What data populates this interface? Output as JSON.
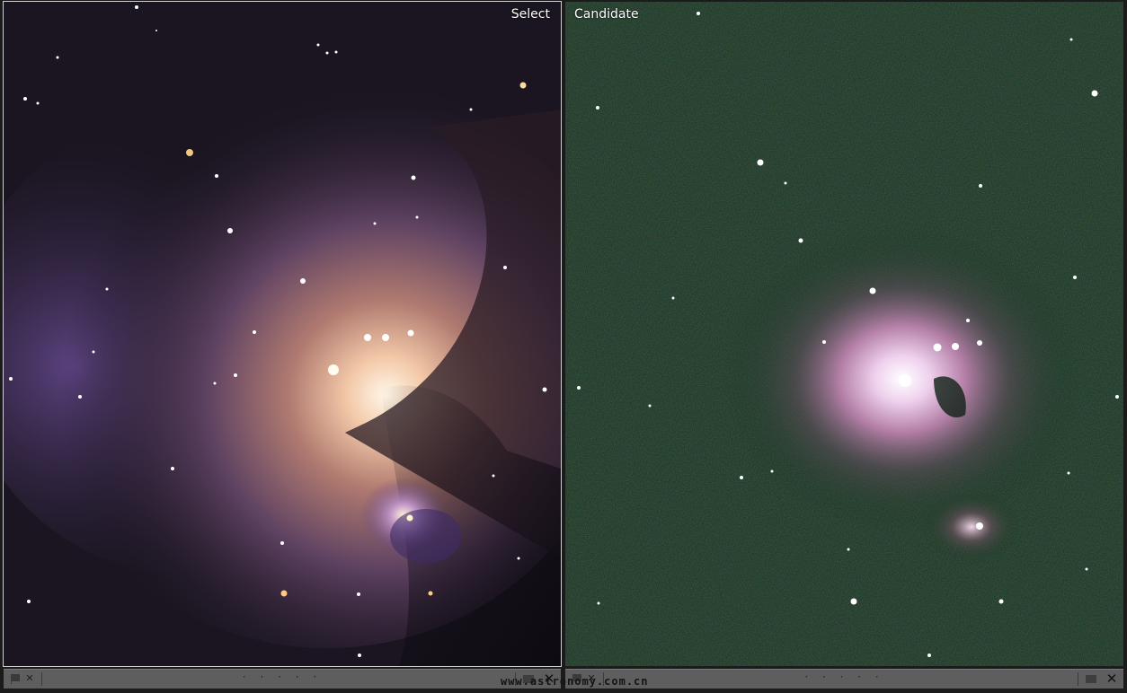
{
  "left_pane": {
    "label": "Select",
    "image_description_name": "orion-nebula-processed"
  },
  "right_pane": {
    "label": "Candidate",
    "image_description_name": "orion-nebula-raw-green"
  },
  "toolbar": {
    "flag_icon": "flag-icon",
    "reject_icon": "reject-x-icon",
    "rating_dots": "· · · · ·",
    "close_icon": "close-icon",
    "close_label": "✕",
    "reject_label": "✕"
  },
  "watermark": "www.astronomy.com.cn",
  "colors": {
    "left_sky": "#1a1520",
    "right_sky": "#0e3318",
    "toolbar_bg": "#5e5e5e",
    "selection_border": "#cfcfcf"
  }
}
